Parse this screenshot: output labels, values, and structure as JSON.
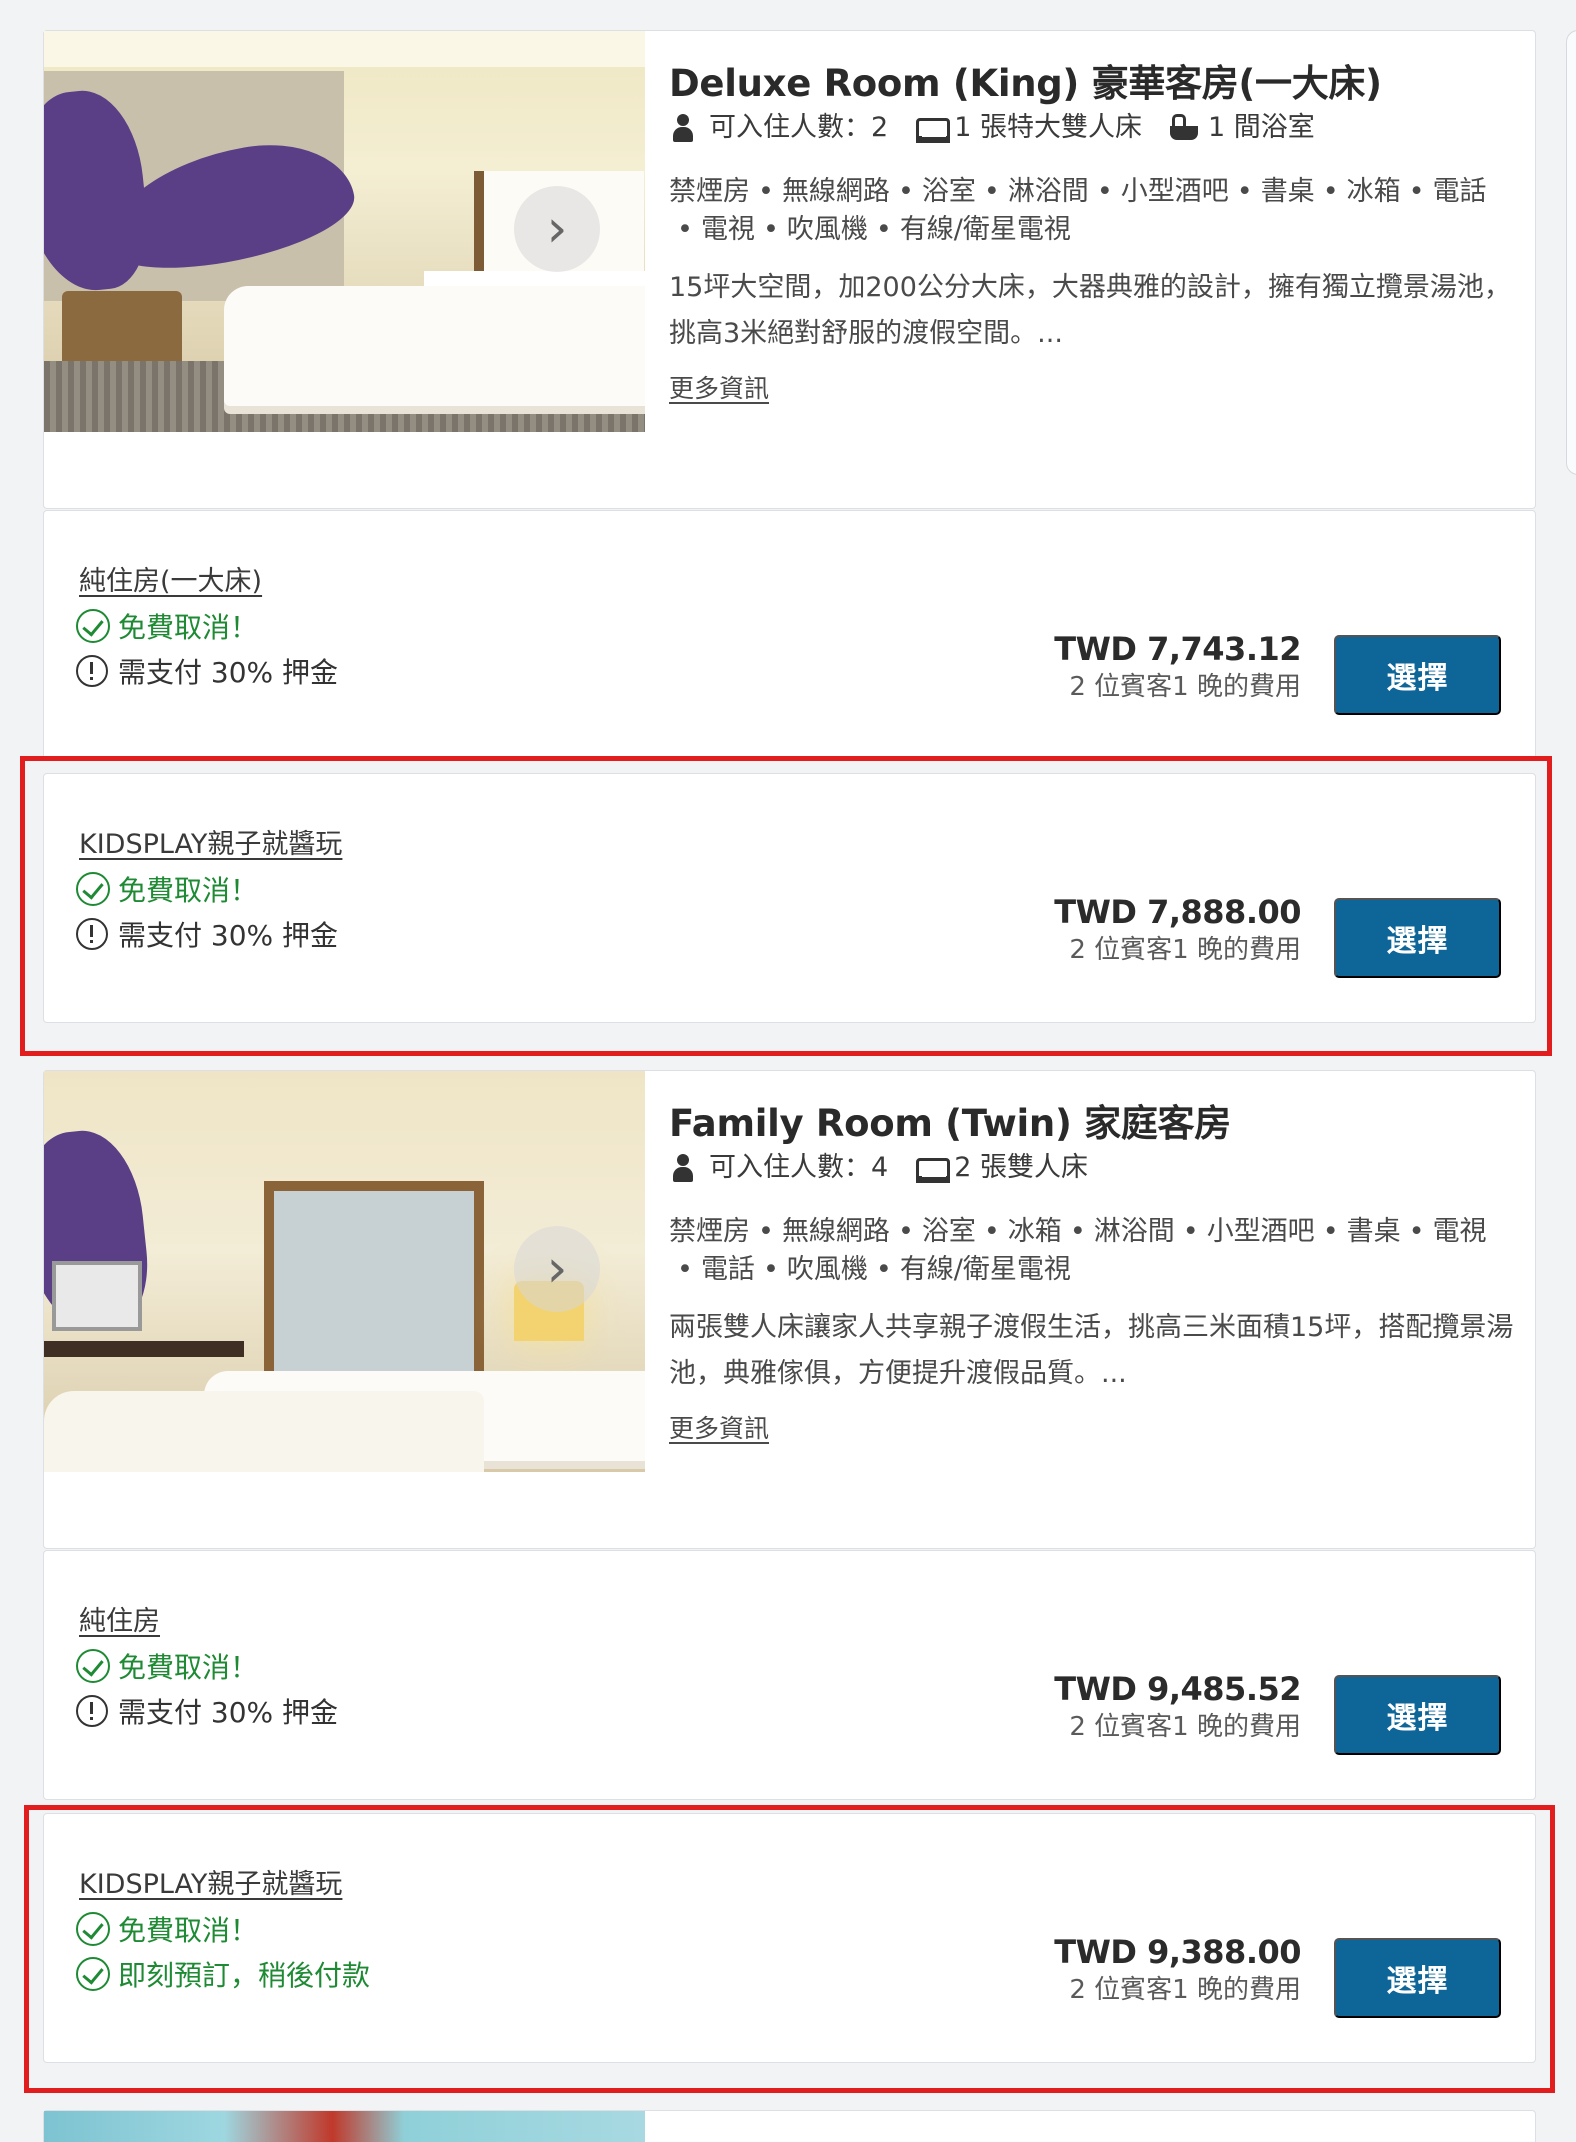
{
  "rooms": [
    {
      "title": "Deluxe Room (King) 豪華客房(一大床)",
      "facts": {
        "occupancy": "可入住人數：2",
        "beds": "1 張特大雙人床",
        "bathrooms": "1 間浴室"
      },
      "amenities": [
        "禁煙房",
        "無線網路",
        "浴室",
        "淋浴間",
        "小型酒吧",
        "書桌",
        "冰箱",
        "電話",
        "電視",
        "吹風機",
        "有線/衛星電視"
      ],
      "description": "15坪大空間，加200公分大床，大器典雅的設計，擁有獨立攬景湯池，挑高3米絕對舒服的渡假空間。...",
      "more_info": "更多資訊",
      "rates": [
        {
          "name": "純住房(一大床)",
          "policies": [
            "免費取消！",
            "需支付 30% 押金"
          ],
          "price": "TWD 7,743.12",
          "price_note": "2 位賓客1 晚的費用",
          "select": "選擇"
        },
        {
          "name": "KIDSPLAY親子就醬玩",
          "policies": [
            "免費取消！",
            "需支付 30% 押金"
          ],
          "price": "TWD 7,888.00",
          "price_note": "2 位賓客1 晚的費用",
          "select": "選擇"
        }
      ]
    },
    {
      "title": "Family Room (Twin) 家庭客房",
      "facts": {
        "occupancy": "可入住人數：4",
        "beds": "2 張雙人床"
      },
      "amenities": [
        "禁煙房",
        "無線網路",
        "浴室",
        "冰箱",
        "淋浴間",
        "小型酒吧",
        "書桌",
        "電視",
        "電話",
        "吹風機",
        "有線/衛星電視"
      ],
      "description": "兩張雙人床讓家人共享親子渡假生活，挑高三米面積15坪，搭配攬景湯池，典雅傢俱，方便提升渡假品質。...",
      "more_info": "更多資訊",
      "rates": [
        {
          "name": "純住房",
          "policies": [
            "免費取消！",
            "需支付 30% 押金"
          ],
          "price": "TWD 9,485.52",
          "price_note": "2 位賓客1 晚的費用",
          "select": "選擇"
        },
        {
          "name": "KIDSPLAY親子就醬玩",
          "policies": [
            "免費取消！",
            "即刻預訂，稍後付款"
          ],
          "price": "TWD 9,388.00",
          "price_note": "2 位賓客1 晚的費用",
          "select": "選擇"
        }
      ]
    }
  ],
  "colors": {
    "button": "#0e6597",
    "highlight": "#e11d1d",
    "policy_green": "#1e8a34"
  },
  "icons": {
    "occupancy": "person-icon",
    "beds": "bed-icon",
    "bathrooms": "bathtub-icon",
    "next": "chevron-right-icon",
    "free_cancel": "check-circle-icon",
    "deposit": "alert-circle-icon"
  }
}
